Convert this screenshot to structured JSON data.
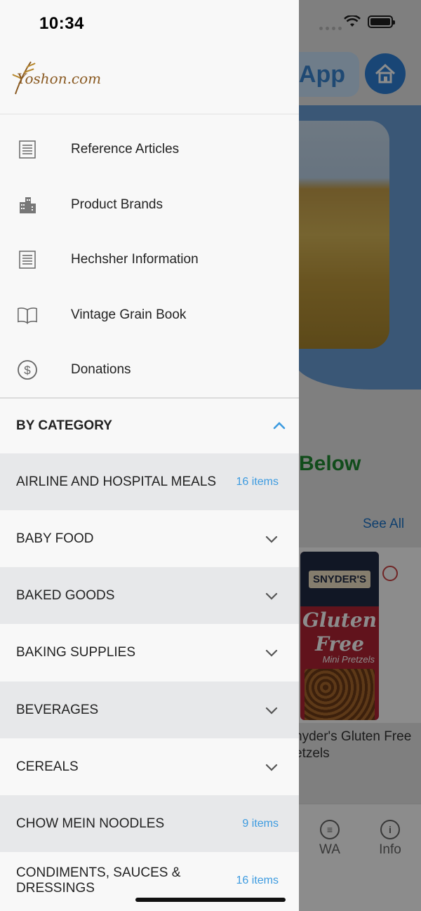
{
  "status_bar": {
    "time": "10:34"
  },
  "drawer": {
    "brand": {
      "logo_text": "Yoshon.com",
      "logo_color": "#8a5a22"
    },
    "menu": [
      {
        "label": "Reference Articles",
        "icon": "document-icon"
      },
      {
        "label": "Product Brands",
        "icon": "buildings-icon"
      },
      {
        "label": "Hechsher Information",
        "icon": "document-icon"
      },
      {
        "label": "Vintage Grain Book",
        "icon": "book-icon"
      },
      {
        "label": "Donations",
        "icon": "dollar-circle-icon"
      }
    ],
    "category_section": {
      "title": "BY CATEGORY",
      "expanded": true
    },
    "categories": [
      {
        "label": "AIRLINE AND HOSPITAL MEALS",
        "count": "16 items"
      },
      {
        "label": "BABY FOOD"
      },
      {
        "label": "BAKED GOODS"
      },
      {
        "label": "BAKING SUPPLIES"
      },
      {
        "label": "BEVERAGES"
      },
      {
        "label": "CEREALS"
      },
      {
        "label": "CHOW MEIN NOODLES",
        "count": "9 items"
      },
      {
        "label": "CONDIMENTS, SAUCES & DRESSINGS",
        "count": "16 items"
      }
    ],
    "accent_color": "#3d9be0"
  },
  "background": {
    "app_button": "App",
    "section_heading": "Below",
    "see_all": "See All",
    "product_name": "nyder's Gluten Free etzels",
    "product_name_lines": [
      "nyder's Gluten Free",
      "etzels"
    ],
    "product_brand": "SNYDER'S",
    "product_text_1": "Gluten",
    "product_text_2": "Free",
    "product_text_3": "Mini Pretzels",
    "tabs": [
      {
        "label": "WA",
        "icon": "chat-icon"
      },
      {
        "label": "Info",
        "icon": "info-icon"
      }
    ]
  }
}
